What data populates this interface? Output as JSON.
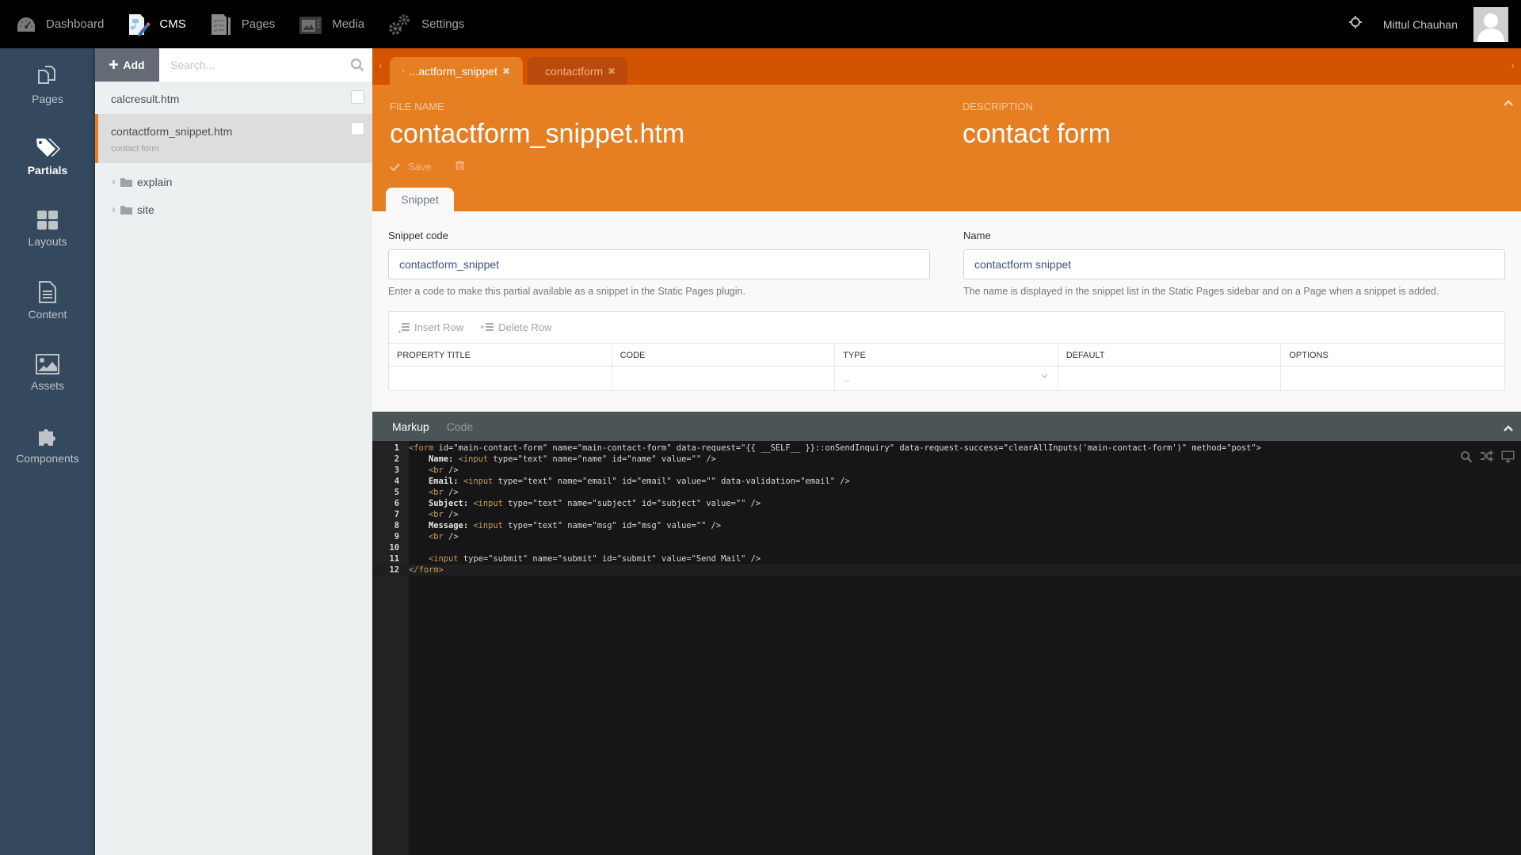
{
  "topnav": {
    "items": [
      {
        "label": "Dashboard",
        "icon": "dashboard-gauge-icon",
        "active": false
      },
      {
        "label": "CMS",
        "icon": "cms-icon",
        "active": true
      },
      {
        "label": "Pages",
        "icon": "pages-icon",
        "active": false
      },
      {
        "label": "Media",
        "icon": "media-icon",
        "active": false
      },
      {
        "label": "Settings",
        "icon": "settings-gears-icon",
        "active": false
      }
    ],
    "user_name": "Mittul Chauhan"
  },
  "sidebar": {
    "items": [
      {
        "label": "Pages",
        "icon": "pages-icon",
        "active": false
      },
      {
        "label": "Partials",
        "icon": "tags-icon",
        "active": true
      },
      {
        "label": "Layouts",
        "icon": "layouts-grid-icon",
        "active": false
      },
      {
        "label": "Content",
        "icon": "content-document-icon",
        "active": false
      },
      {
        "label": "Assets",
        "icon": "assets-image-icon",
        "active": false
      },
      {
        "label": "Components",
        "icon": "components-puzzle-icon",
        "active": false
      }
    ]
  },
  "filelist": {
    "add_label": "Add",
    "search_placeholder": "Search...",
    "search_value": "",
    "files": [
      {
        "name": "calcresult.htm",
        "description": ""
      },
      {
        "name": "contactform_snippet.htm",
        "description": "contact form",
        "selected": true
      }
    ],
    "folders": [
      "explain",
      "site"
    ]
  },
  "tabs": [
    {
      "label": "...actform_snippet",
      "icon": "tag-icon",
      "active": true
    },
    {
      "label": "contactform",
      "icon": "pages-icon",
      "active": false
    }
  ],
  "header": {
    "file_name_label": "FILE NAME",
    "file_name": "contactform_snippet.htm",
    "description_label": "DESCRIPTION",
    "description": "contact form",
    "save_label": "Save",
    "section_tab": "Snippet"
  },
  "form": {
    "snippet_code": {
      "label": "Snippet code",
      "value": "contactform_snippet",
      "help": "Enter a code to make this partial available as a snippet in the Static Pages plugin."
    },
    "name": {
      "label": "Name",
      "value": "contactform snippet",
      "help": "The name is displayed in the snippet list in the Static Pages sidebar and on a Page when a snippet is added."
    },
    "properties": {
      "insert_row_label": "Insert Row",
      "delete_row_label": "Delete Row",
      "columns": [
        "PROPERTY TITLE",
        "CODE",
        "TYPE",
        "DEFAULT",
        "OPTIONS"
      ],
      "rows": [
        {
          "property_title": "",
          "code": "",
          "type": "...",
          "default": "",
          "options": ""
        }
      ]
    }
  },
  "editor": {
    "tabs": [
      {
        "label": "Markup",
        "active": true
      },
      {
        "label": "Code",
        "active": false
      }
    ],
    "lines": [
      "<form id=\"main-contact-form\" name=\"main-contact-form\" data-request=\"{{ __SELF__ }}::onSendInquiry\" data-request-success=\"clearAllInputs('main-contact-form')\" method=\"post\">",
      "    Name: <input type=\"text\" name=\"name\" id=\"name\" value=\"\" />",
      "    <br />",
      "    Email: <input type=\"text\" name=\"email\" id=\"email\" value=\"\" data-validation=\"email\" />",
      "    <br />",
      "    Subject: <input type=\"text\" name=\"subject\" id=\"subject\" value=\"\" />",
      "    <br />",
      "    Message: <input type=\"text\" name=\"msg\" id=\"msg\" value=\"\" />",
      "    <br />",
      "",
      "    <input type=\"submit\" name=\"submit\" id=\"submit\" value=\"Send Mail\" />",
      "</form>"
    ],
    "current_line": 12
  },
  "colors": {
    "accent": "#e67e22",
    "tabstrip": "#d35400",
    "sidebar": "#34495e",
    "topbar": "#000000"
  }
}
